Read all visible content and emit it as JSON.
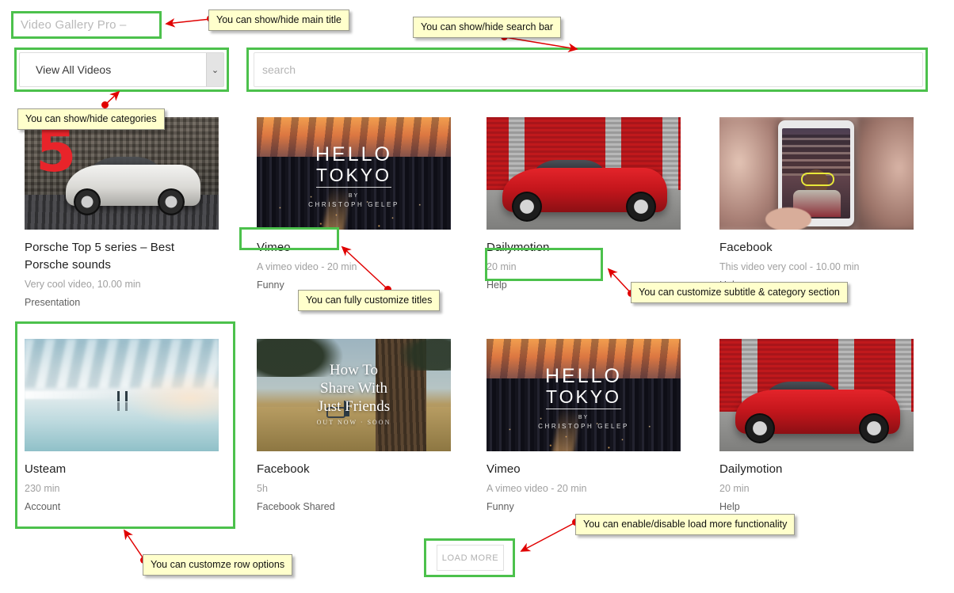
{
  "header": {
    "main_title_placeholder": "Video Gallery Pro –",
    "category_select_value": "View All Videos",
    "search_placeholder": "search",
    "chevron_glyph": "⌄"
  },
  "videos": [
    {
      "title": "Porsche Top 5 series – Best Porsche sounds",
      "subtitle": "Very cool video, 10.00 min",
      "category": "Presentation",
      "thumb": "porsche-studio-white-car",
      "thumb_text": {
        "badge": "5"
      }
    },
    {
      "title": "Vimeo",
      "subtitle": "A vimeo video - 20 min",
      "category": "Funny",
      "thumb": "hello-tokyo-skyline",
      "thumb_text": {
        "l1": "HELLO",
        "l2": "TOKYO",
        "l3": "BY",
        "l4": "CHRISTOPH GELEP"
      }
    },
    {
      "title": "Dailymotion",
      "subtitle": "20 min",
      "category": "Help",
      "thumb": "red-ferrari-garage"
    },
    {
      "title": "Facebook",
      "subtitle": "This video very cool - 10.00 min",
      "category": "Help",
      "thumb": "phone-ar-filter"
    },
    {
      "title": "Usteam",
      "subtitle": "230 min",
      "category": "Account",
      "thumb": "pale-blue-sea"
    },
    {
      "title": "Facebook",
      "subtitle": "5h",
      "category": "Facebook Shared",
      "thumb": "how-to-share-tree",
      "thumb_text": {
        "a1": "How To",
        "a2": "Share With",
        "a3": "Just Friends",
        "b": "OUT NOW · SOON"
      }
    },
    {
      "title": "Vimeo",
      "subtitle": "A vimeo video - 20 min",
      "category": "Funny",
      "thumb": "hello-tokyo-skyline",
      "thumb_text": {
        "l1": "HELLO",
        "l2": "TOKYO",
        "l3": "BY",
        "l4": "CHRISTOPH GELEP"
      }
    },
    {
      "title": "Dailymotion",
      "subtitle": "20 min",
      "category": "Help",
      "thumb": "red-ferrari-garage"
    }
  ],
  "load_more_label": "LOAD MORE",
  "callouts": [
    {
      "id": "main-title",
      "text": "You can show/hide main title"
    },
    {
      "id": "search-bar",
      "text": "You can show/hide search bar"
    },
    {
      "id": "categories",
      "text": "You can show/hide categories"
    },
    {
      "id": "titles",
      "text": "You can fully customize titles"
    },
    {
      "id": "subtitle-cat",
      "text": "You can customize subtitle & category section"
    },
    {
      "id": "row-options",
      "text": "You can customze row options"
    },
    {
      "id": "load-more",
      "text": "You can enable/disable load more functionality"
    }
  ],
  "colors": {
    "highlight": "#4CC14C",
    "callout_bg": "#FFFFCC",
    "arrow": "#E00000"
  }
}
